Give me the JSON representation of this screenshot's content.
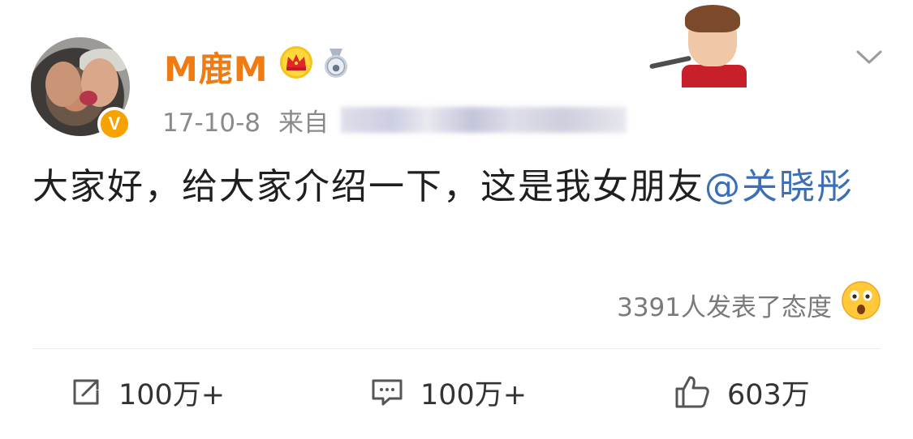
{
  "post": {
    "username": "M鹿M",
    "date": "17-10-8",
    "source_prefix": "来自",
    "text": "大家好，给大家介绍一下，这是我女朋友",
    "mention": "@关晓彤",
    "reactions_text": "3391人发表了态度"
  },
  "actions": {
    "repost_count": "100万+",
    "comment_count": "100万+",
    "like_count": "603万"
  },
  "colors": {
    "username": "#f07b12",
    "mention": "#3d6fb6",
    "badge": "#f6a200"
  },
  "icons": [
    "crown-icon",
    "medal-icon",
    "chevron-down-icon",
    "wow-emoji-icon",
    "repost-icon",
    "comment-icon",
    "like-icon",
    "verified-v-icon"
  ],
  "badge": {
    "verified_label": "V"
  }
}
